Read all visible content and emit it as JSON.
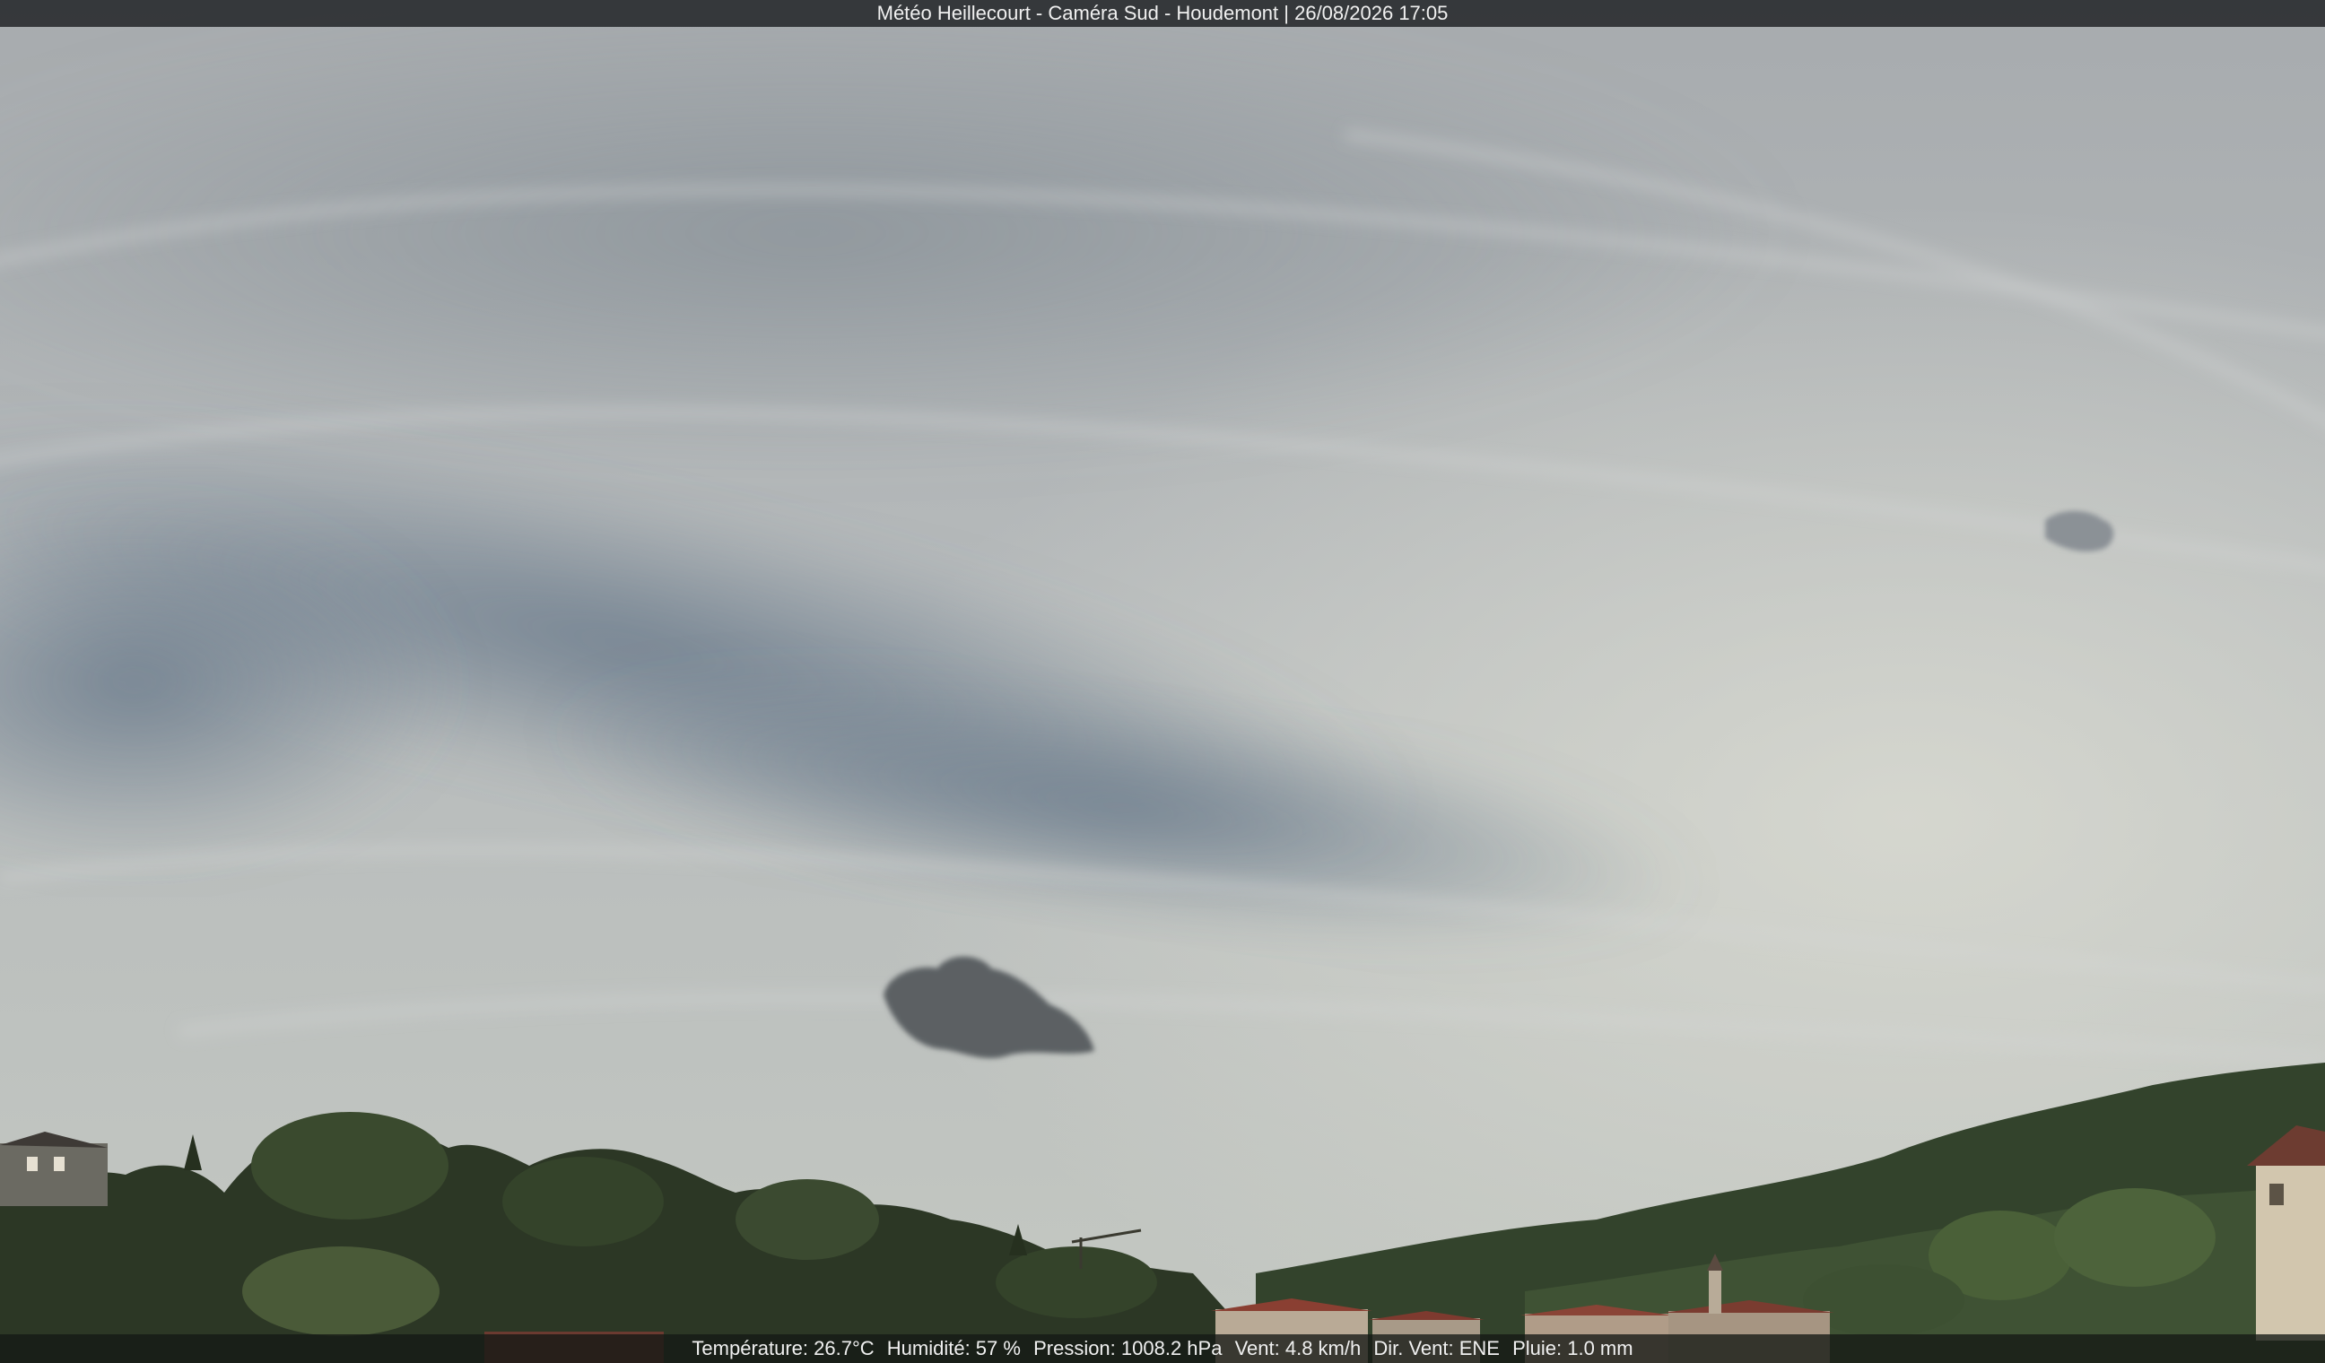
{
  "overlay": {
    "title": "Météo Heillecourt - Caméra Sud - Houdemont | 26/08/2026 17:05",
    "temperature": "Température: 26.7°C",
    "humidity": "Humidité: 57 %",
    "pressure": "Pression: 1008.2 hPa",
    "wind": "Vent: 4.8 km/h",
    "wind_dir": "Dir. Vent: ENE",
    "rain": "Pluie: 1.0 mm"
  },
  "colors": {
    "sky_light": "#c9ccc6",
    "sky_dark": "#6f7f8e",
    "trees": "#2f3a26",
    "roof": "#8a3f32"
  }
}
